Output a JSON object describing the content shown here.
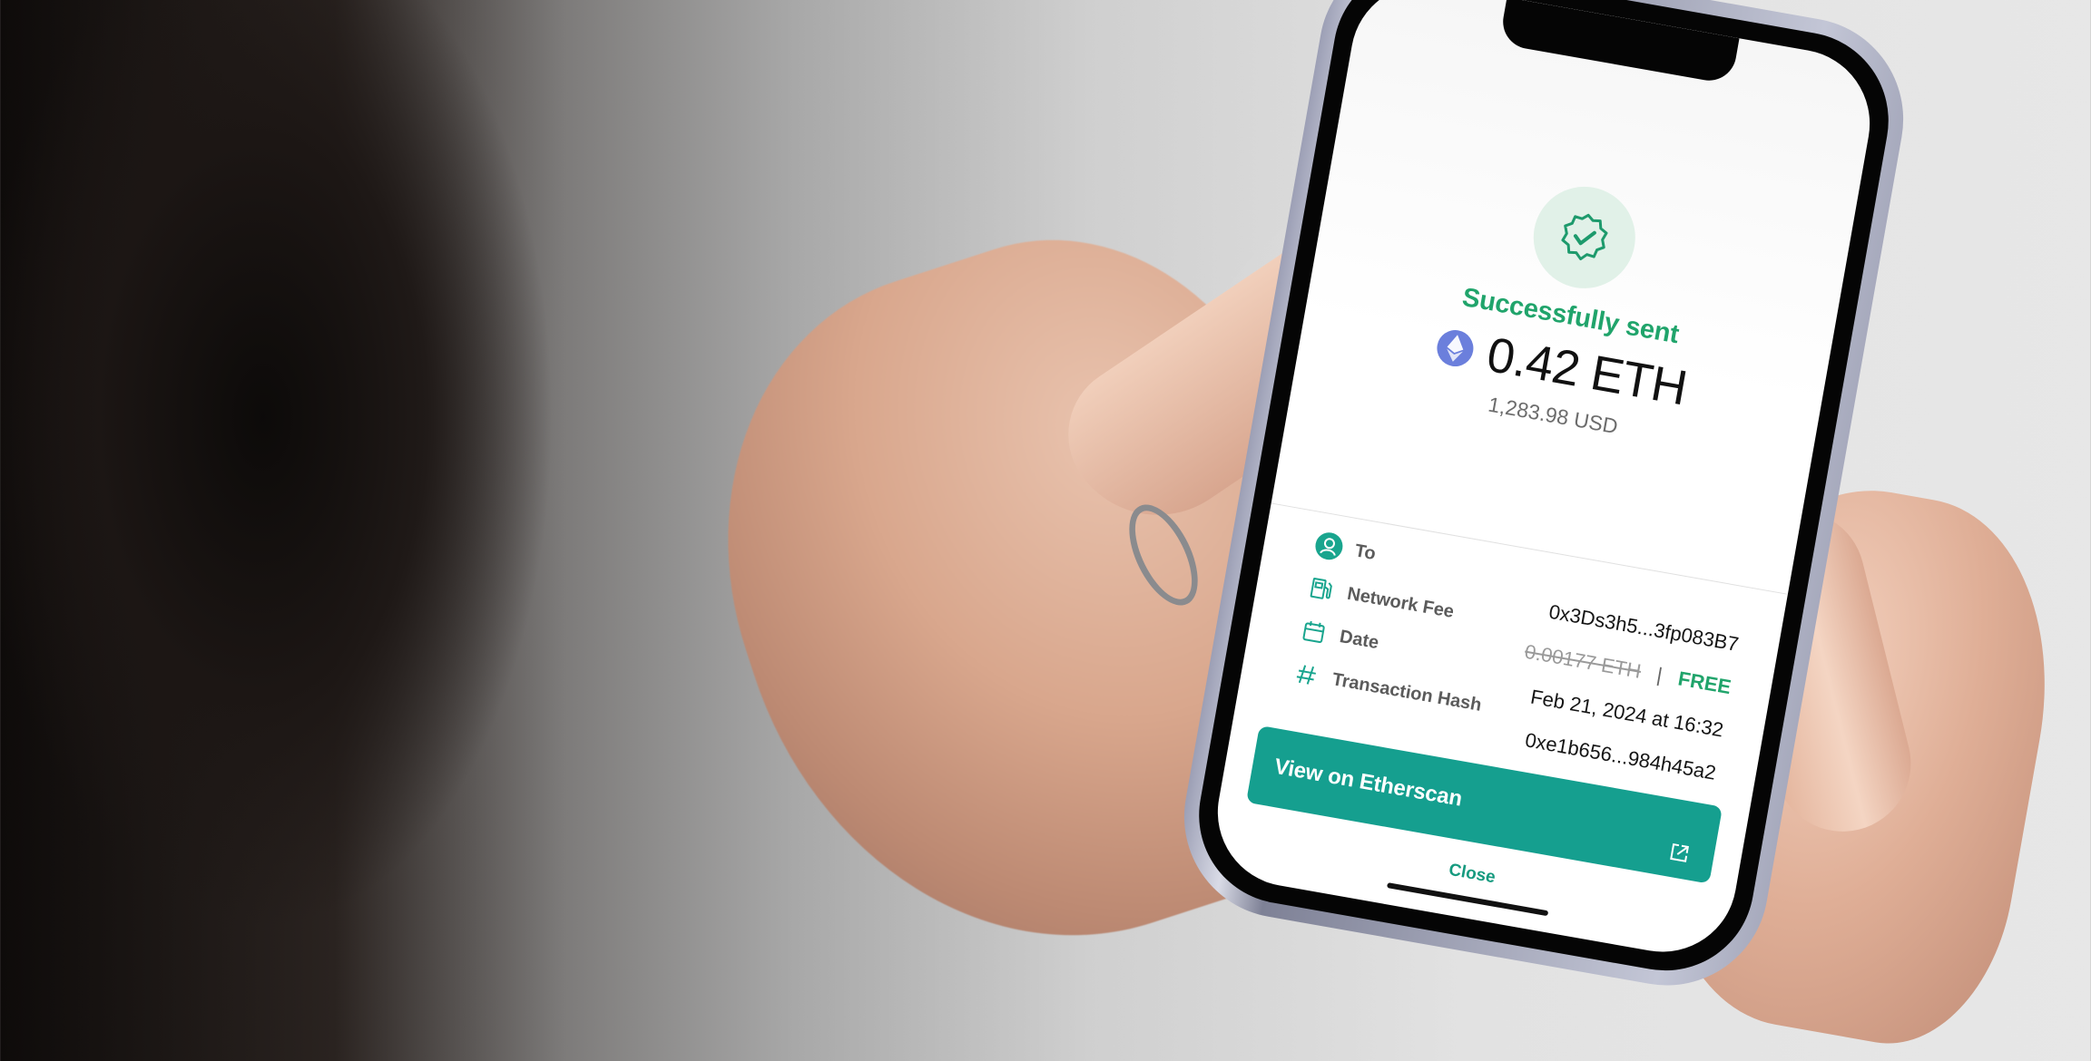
{
  "status": {
    "title": "Successfully sent",
    "amount": "0.42 ETH",
    "amount_usd": "1,283.98 USD"
  },
  "details": {
    "to": {
      "label": "To",
      "value": "0x3Ds3h5...3fp083B7"
    },
    "network_fee": {
      "label": "Network Fee",
      "old_value": "0.00177 ETH",
      "separator": "|",
      "new_value": "FREE"
    },
    "date": {
      "label": "Date",
      "value": "Feb 21, 2024 at 16:32"
    },
    "transaction_hash": {
      "label": "Transaction Hash",
      "value": "0xe1b656...984h45a2"
    }
  },
  "actions": {
    "view_etherscan": "View on Etherscan",
    "close": "Close"
  },
  "colors": {
    "success_green": "#20a46b",
    "button_teal": "#159f8f",
    "eth_purple": "#6b7fdc"
  },
  "icons": {
    "status": "verified-badge-check-icon",
    "currency": "ethereum-icon",
    "to": "user-circle-icon",
    "network_fee": "fuel-pump-icon",
    "date": "calendar-icon",
    "transaction_hash": "hash-icon",
    "external_link": "external-link-icon"
  }
}
